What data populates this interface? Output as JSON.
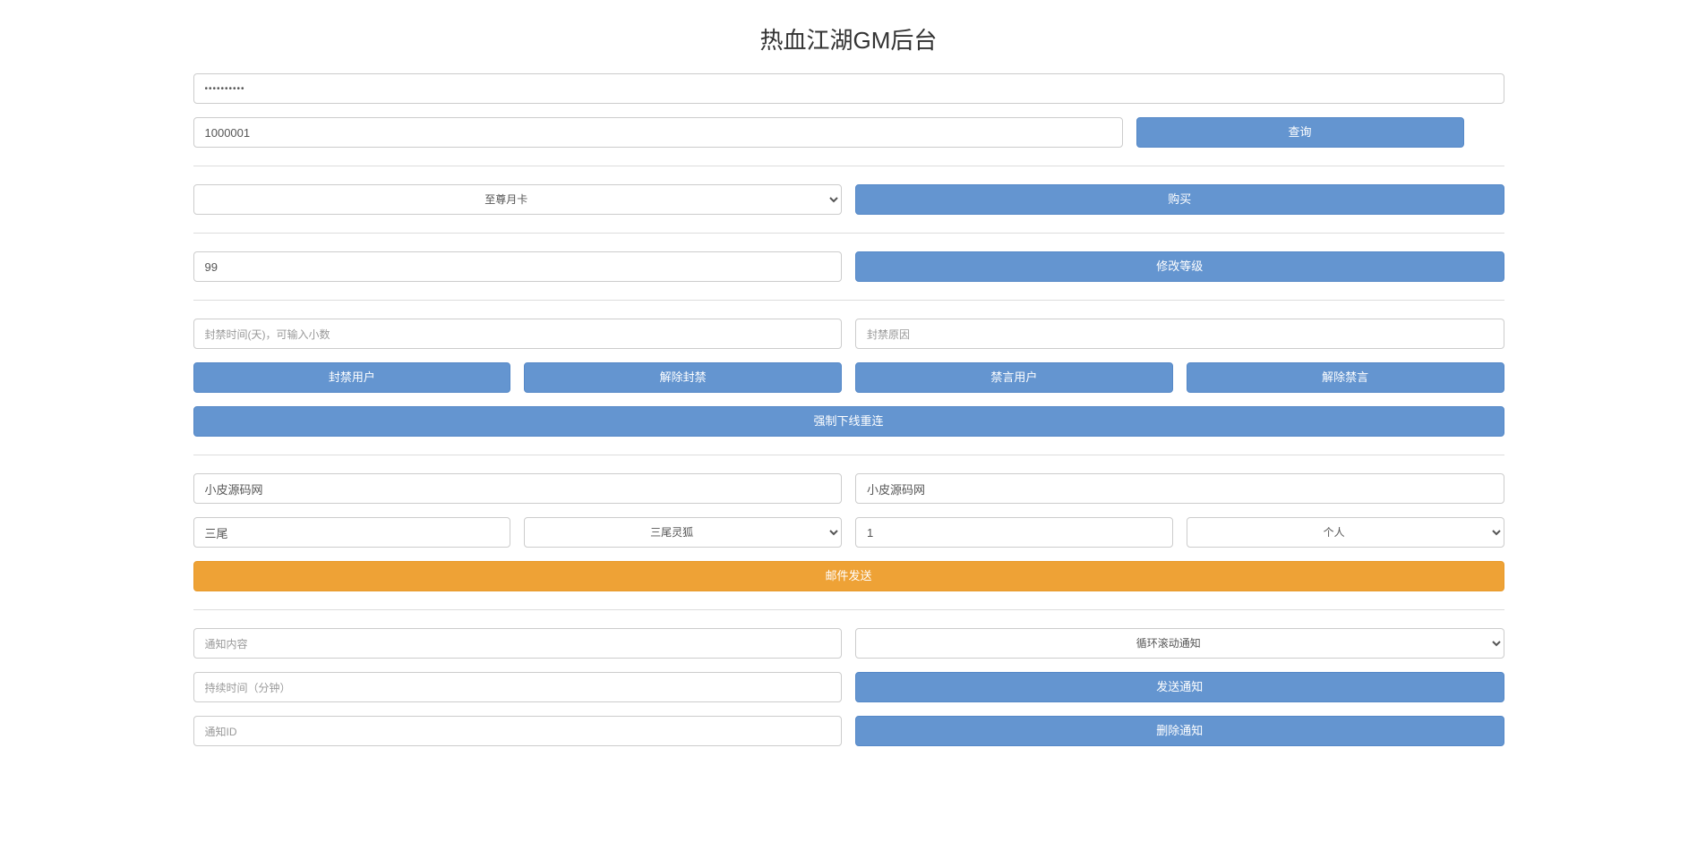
{
  "header": {
    "title": "热血江湖GM后台"
  },
  "auth": {
    "password_value": "••••••••••"
  },
  "query": {
    "user_id_value": "1000001",
    "query_button": "查询"
  },
  "purchase": {
    "card_selected": "至尊月卡",
    "buy_button": "购买"
  },
  "level": {
    "level_value": "99",
    "modify_button": "修改等级"
  },
  "ban": {
    "duration_placeholder": "封禁时间(天)，可输入小数",
    "reason_placeholder": "封禁原因",
    "ban_user_button": "封禁用户",
    "unban_button": "解除封禁",
    "mute_button": "禁言用户",
    "unmute_button": "解除禁言",
    "force_offline_button": "强制下线重连"
  },
  "mail": {
    "sender_value": "小皮源码网",
    "recipient_value": "小皮源码网",
    "item_name_value": "三尾",
    "item_selected": "三尾灵狐",
    "quantity_value": "1",
    "scope_selected": "个人",
    "send_button": "邮件发送"
  },
  "notification": {
    "content_placeholder": "通知内容",
    "type_selected": "循环滚动通知",
    "duration_placeholder": "持续时间（分钟）",
    "send_button": "发送通知",
    "id_placeholder": "通知ID",
    "delete_button": "删除通知"
  }
}
